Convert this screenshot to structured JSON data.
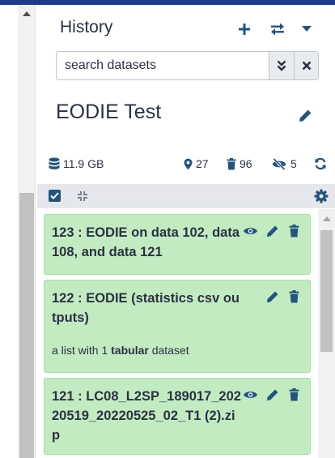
{
  "history": {
    "title": "History",
    "name": "EODIE Test"
  },
  "search": {
    "placeholder": "search datasets"
  },
  "stats": {
    "size": "11.9 GB",
    "shown": "27",
    "deleted": "96",
    "hidden": "5"
  },
  "datasets": [
    {
      "title": "123 : EODIE on data 102, data 108, and data 121",
      "description_prefix": "",
      "description_type": "",
      "description_suffix": ""
    },
    {
      "title": "122 : EODIE (statistics csv outputs)",
      "description_prefix": "a list with 1 ",
      "description_type": "tabular",
      "description_suffix": " dataset"
    },
    {
      "title": "121 : LC08_L2SP_189017_20220519_20220525_02_T1 (2).zip",
      "description_prefix": "",
      "description_type": "",
      "description_suffix": ""
    }
  ],
  "colors": {
    "brand_bar": "#1e3a8a",
    "text": "#2c3143",
    "dataset_ok_bg": "#c2ebc2",
    "checkbox": "#25537b"
  },
  "icons": {
    "new_history": "plus-icon",
    "switch_history": "exchange-icon",
    "history_options": "caret-down-icon",
    "advanced_search": "double-chevron-down-icon",
    "clear_search": "close-icon",
    "edit": "pencil-icon",
    "size": "database-icon",
    "shown": "map-marker-icon",
    "deleted": "trash-icon",
    "hidden": "eye-slash-icon",
    "reload": "sync-icon",
    "select_all": "checkbox-icon",
    "collapse": "compress-icon",
    "settings": "gear-icon",
    "view": "eye-icon"
  }
}
